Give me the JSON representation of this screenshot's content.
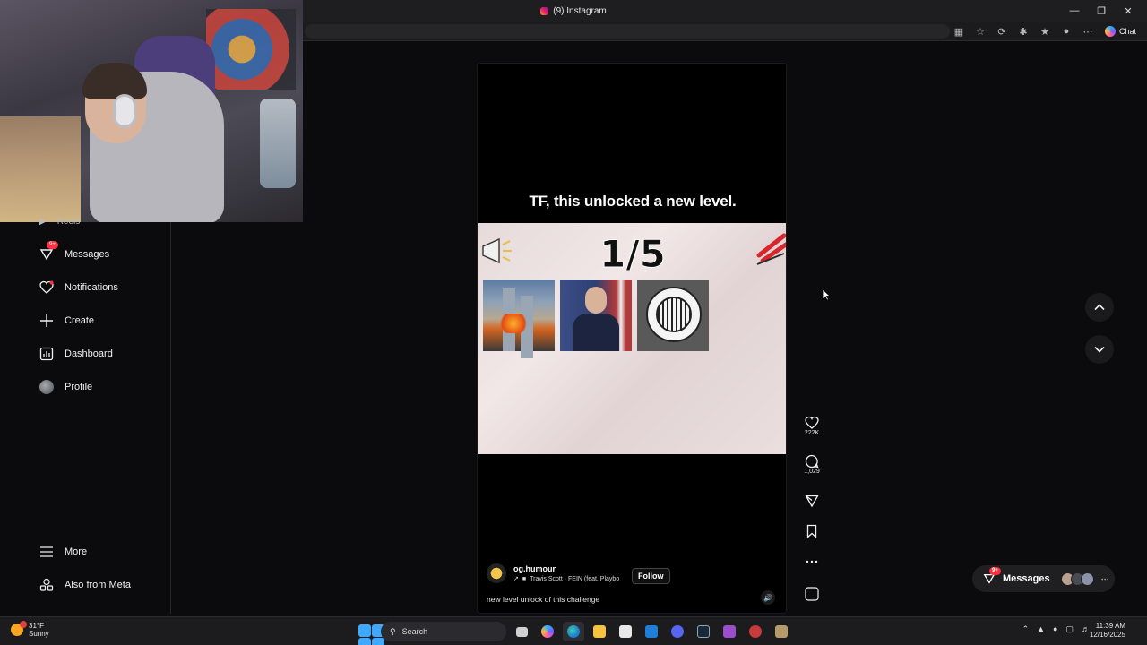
{
  "window": {
    "title": "(9) Instagram",
    "controls": [
      "minimize",
      "restore",
      "close"
    ]
  },
  "browser": {
    "chat_label": "Chat"
  },
  "sidebar": {
    "items": [
      {
        "label": "Reels",
        "icon": "reels-icon"
      },
      {
        "label": "Messages",
        "icon": "messages-icon",
        "badge": "9+"
      },
      {
        "label": "Notifications",
        "icon": "heart-icon"
      },
      {
        "label": "Create",
        "icon": "plus-icon"
      },
      {
        "label": "Dashboard",
        "icon": "dashboard-icon"
      },
      {
        "label": "Profile",
        "icon": "avatar"
      },
      {
        "label": "More",
        "icon": "menu-icon"
      },
      {
        "label": "Also from Meta",
        "icon": "meta-icon"
      }
    ]
  },
  "reel": {
    "caption": "TF, this unlocked a new level.",
    "counter": "1/5",
    "username": "og.humour",
    "music": "Travis Scott · FEIN (feat. Playbo",
    "follow_label": "Follow",
    "description": "new level unlock of this challenge"
  },
  "actions": {
    "likes": "222K",
    "comments": "1,029"
  },
  "messages_pill": {
    "label": "Messages",
    "badge": "9+"
  },
  "taskbar": {
    "temperature": "31°F",
    "condition": "Sunny",
    "search_placeholder": "Search",
    "time": "11:39 AM",
    "date": "12/16/2025"
  },
  "colors": {
    "background": "#0b0b0d",
    "badge_red": "#ff3040",
    "windows_blue": "#3fa9ff"
  }
}
